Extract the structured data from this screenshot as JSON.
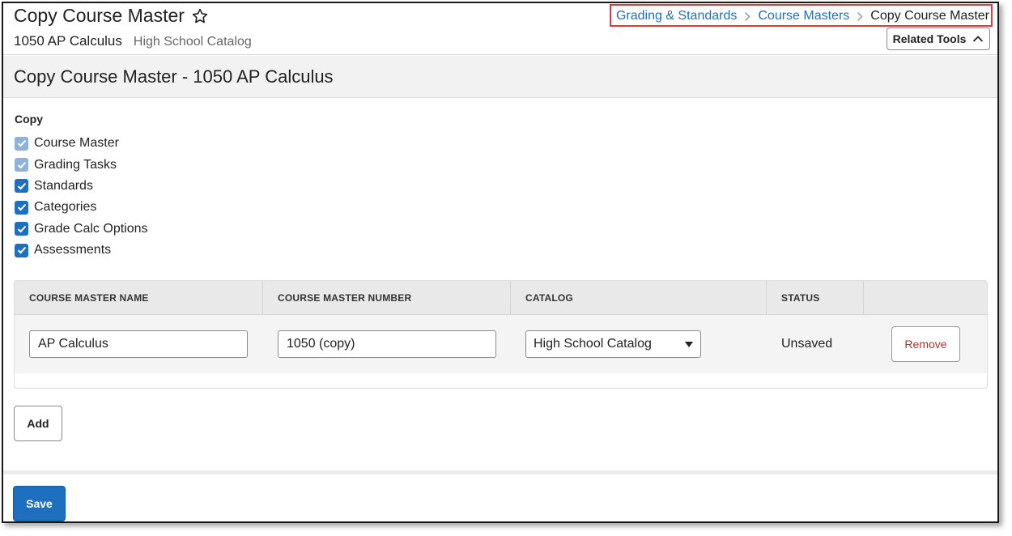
{
  "header": {
    "title": "Copy Course Master",
    "course": "1050 AP Calculus",
    "catalog": "High School Catalog"
  },
  "breadcrumb": {
    "items": [
      "Grading & Standards",
      "Course Masters"
    ],
    "current": "Copy Course Master"
  },
  "related_tools": {
    "label": "Related Tools"
  },
  "section": {
    "title": "Copy Course Master - 1050 AP Calculus"
  },
  "copy_options": {
    "label": "Copy",
    "items": [
      {
        "label": "Course Master",
        "checked": true,
        "disabled": true
      },
      {
        "label": "Grading Tasks",
        "checked": true,
        "disabled": true
      },
      {
        "label": "Standards",
        "checked": true,
        "disabled": false
      },
      {
        "label": "Categories",
        "checked": true,
        "disabled": false
      },
      {
        "label": "Grade Calc Options",
        "checked": true,
        "disabled": false
      },
      {
        "label": "Assessments",
        "checked": true,
        "disabled": false
      }
    ]
  },
  "table": {
    "columns": [
      "COURSE MASTER NAME",
      "COURSE MASTER NUMBER",
      "CATALOG",
      "STATUS"
    ],
    "rows": [
      {
        "name": "AP Calculus",
        "number": "1050 (copy)",
        "catalog": "High School Catalog",
        "status": "Unsaved",
        "remove_label": "Remove"
      }
    ]
  },
  "buttons": {
    "add": "Add",
    "save": "Save"
  },
  "colors": {
    "primary": "#1f6fbf",
    "highlight": "#e03c3c",
    "danger": "#c62828"
  },
  "icons": {
    "favorite": "star-outline-icon",
    "related": "chevron-up-icon",
    "separator": "chevron-right-icon",
    "dropdown": "caret-down-icon"
  }
}
